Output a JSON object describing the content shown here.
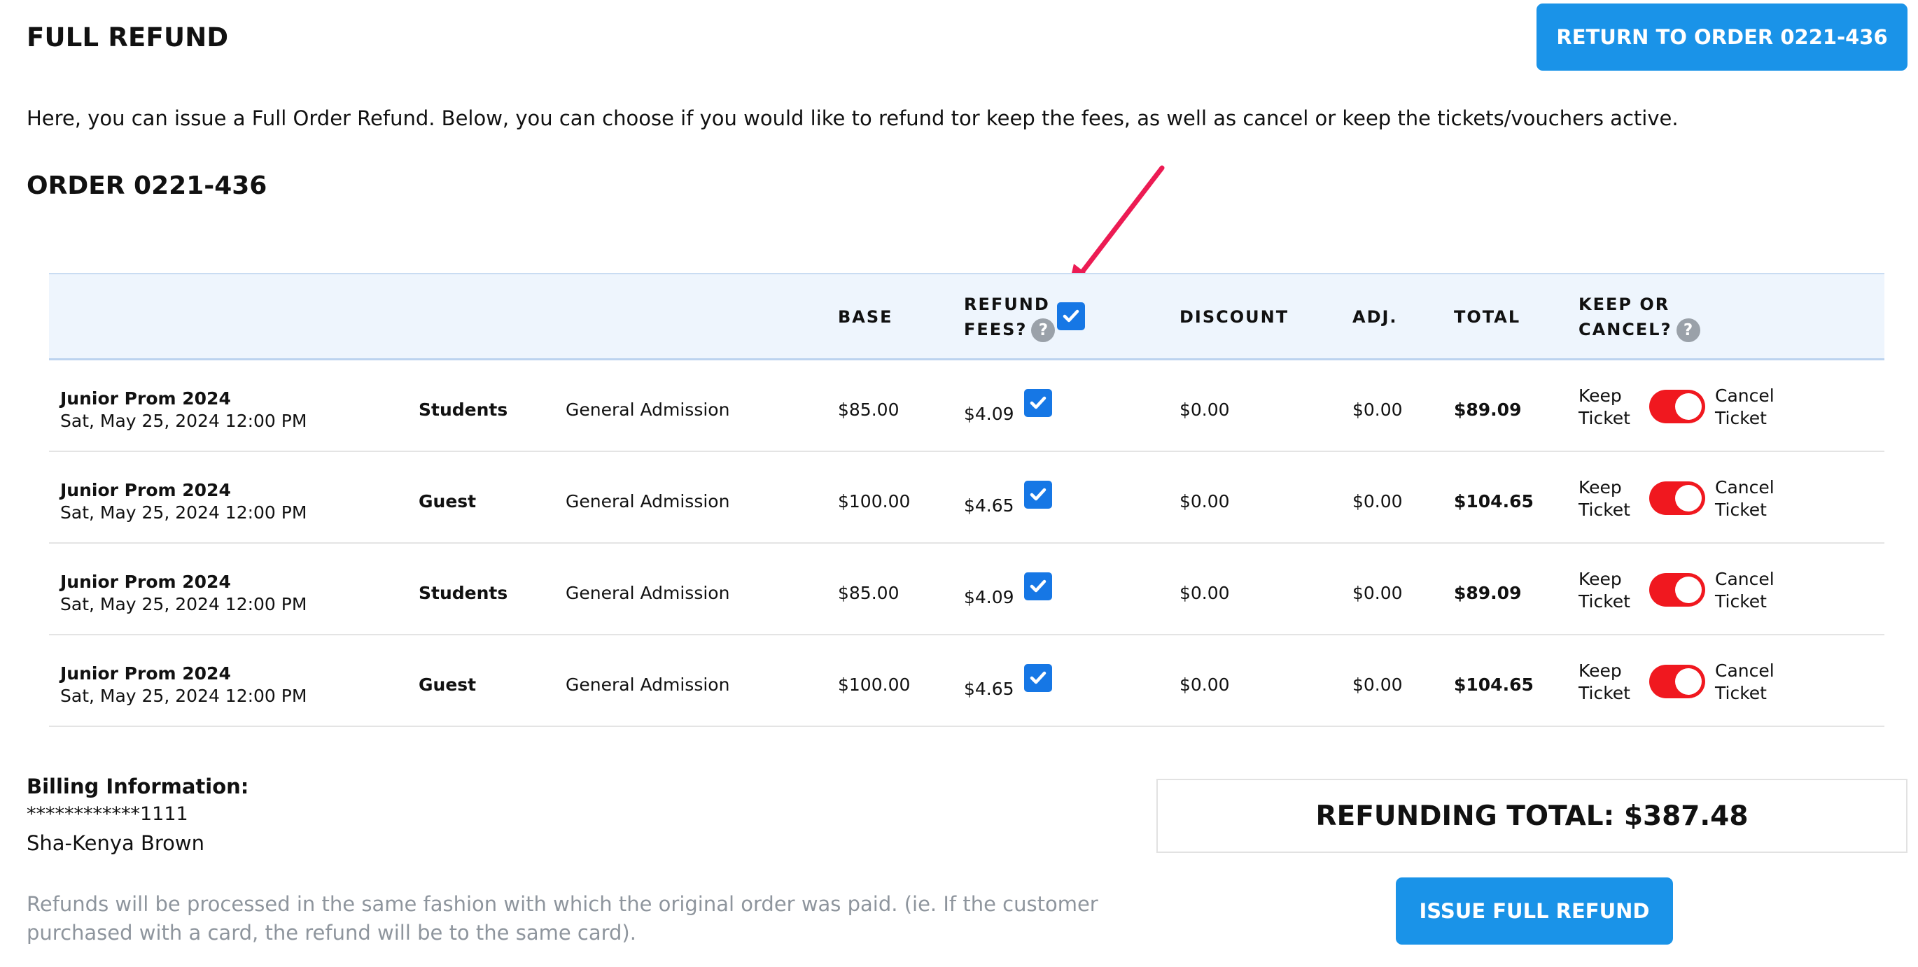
{
  "header": {
    "title": "FULL REFUND",
    "return_button": "RETURN TO ORDER 0221-436"
  },
  "intro_text": "Here, you can issue a Full Order Refund. Below, you can choose if you would like to refund tor keep the fees, as well as cancel or keep the tickets/vouchers active.",
  "order": {
    "title": "ORDER 0221-436"
  },
  "table": {
    "columns": {
      "base": "BASE",
      "refund_fees_line1": "REFUND",
      "refund_fees_line2": "FEES?",
      "discount": "DISCOUNT",
      "adj": "ADJ.",
      "total": "TOTAL",
      "keep_cancel_line1": "KEEP OR",
      "keep_cancel_line2": "CANCEL?"
    },
    "help_glyph": "?",
    "refund_all_fees_checked": true,
    "rows": [
      {
        "event": "Junior Prom 2024",
        "date": "Sat, May 25, 2024 12:00 PM",
        "ticket_type": "Students",
        "admission": "General Admission",
        "base": "$85.00",
        "fees": "$4.09",
        "refund_fee_checked": true,
        "discount": "$0.00",
        "adj": "$0.00",
        "total": "$89.09",
        "keep_line1": "Keep",
        "keep_line2": "Ticket",
        "cancel_line1": "Cancel",
        "cancel_line2": "Ticket",
        "toggle_state": "cancel"
      },
      {
        "event": "Junior Prom 2024",
        "date": "Sat, May 25, 2024 12:00 PM",
        "ticket_type": "Guest",
        "admission": "General Admission",
        "base": "$100.00",
        "fees": "$4.65",
        "refund_fee_checked": true,
        "discount": "$0.00",
        "adj": "$0.00",
        "total": "$104.65",
        "keep_line1": "Keep",
        "keep_line2": "Ticket",
        "cancel_line1": "Cancel",
        "cancel_line2": "Ticket",
        "toggle_state": "cancel"
      },
      {
        "event": "Junior Prom 2024",
        "date": "Sat, May 25, 2024 12:00 PM",
        "ticket_type": "Students",
        "admission": "General Admission",
        "base": "$85.00",
        "fees": "$4.09",
        "refund_fee_checked": true,
        "discount": "$0.00",
        "adj": "$0.00",
        "total": "$89.09",
        "keep_line1": "Keep",
        "keep_line2": "Ticket",
        "cancel_line1": "Cancel",
        "cancel_line2": "Ticket",
        "toggle_state": "cancel"
      },
      {
        "event": "Junior Prom 2024",
        "date": "Sat, May 25, 2024 12:00 PM",
        "ticket_type": "Guest",
        "admission": "General Admission",
        "base": "$100.00",
        "fees": "$4.65",
        "refund_fee_checked": true,
        "discount": "$0.00",
        "adj": "$0.00",
        "total": "$104.65",
        "keep_line1": "Keep",
        "keep_line2": "Ticket",
        "cancel_line1": "Cancel",
        "cancel_line2": "Ticket",
        "toggle_state": "cancel"
      }
    ]
  },
  "billing": {
    "title": "Billing Information:",
    "card": "************1111",
    "name": "Sha-Kenya Brown"
  },
  "note": "Refunds will be processed in the same fashion with which the original order was paid. (ie. If the customer purchased with a card, the refund will be to the same card).",
  "refund_total": "REFUNDING TOTAL: $387.48",
  "issue_button": "ISSUE FULL REFUND",
  "colors": {
    "primary_button": "#1a93e8",
    "checkbox": "#1677e5",
    "toggle_on": "#f0181f",
    "annotation_arrow": "#ec1b53",
    "header_bg": "#eef5fd"
  }
}
